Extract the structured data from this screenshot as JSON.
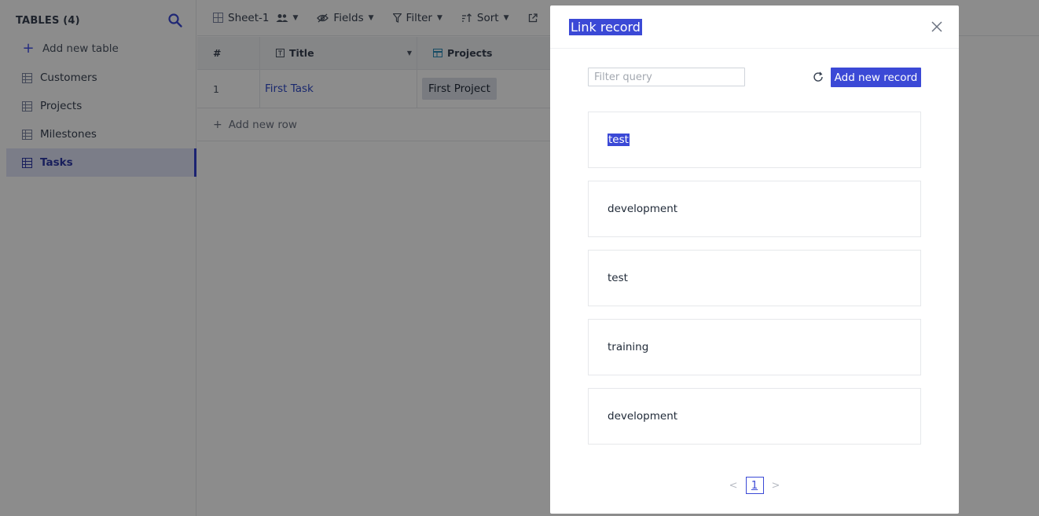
{
  "sidebar": {
    "title": "TABLES (4)",
    "add_label": "Add new table",
    "items": [
      {
        "label": "Customers"
      },
      {
        "label": "Projects"
      },
      {
        "label": "Milestones"
      },
      {
        "label": "Tasks",
        "active": true
      }
    ]
  },
  "toolbar": {
    "sheet_label": "Sheet-1",
    "fields_label": "Fields",
    "filter_label": "Filter",
    "sort_label": "Sort"
  },
  "grid": {
    "columns": {
      "num": "#",
      "title": "Title",
      "projects": "Projects"
    },
    "rows": [
      {
        "num": "1",
        "title": "First Task",
        "project": "First Project"
      }
    ],
    "add_row_label": "Add new row"
  },
  "modal": {
    "title": "Link record",
    "filter_placeholder": "Filter query",
    "add_record_label": "Add new record",
    "records": [
      {
        "label": "test",
        "selected": true
      },
      {
        "label": "development"
      },
      {
        "label": "test"
      },
      {
        "label": "training"
      },
      {
        "label": "development"
      }
    ],
    "pagination": {
      "current_page": "1"
    }
  },
  "colors": {
    "accent": "#3b49d6",
    "sidebar_active_bg": "#e0e4f7",
    "overlay": "rgba(0,0,0,0.45)"
  }
}
